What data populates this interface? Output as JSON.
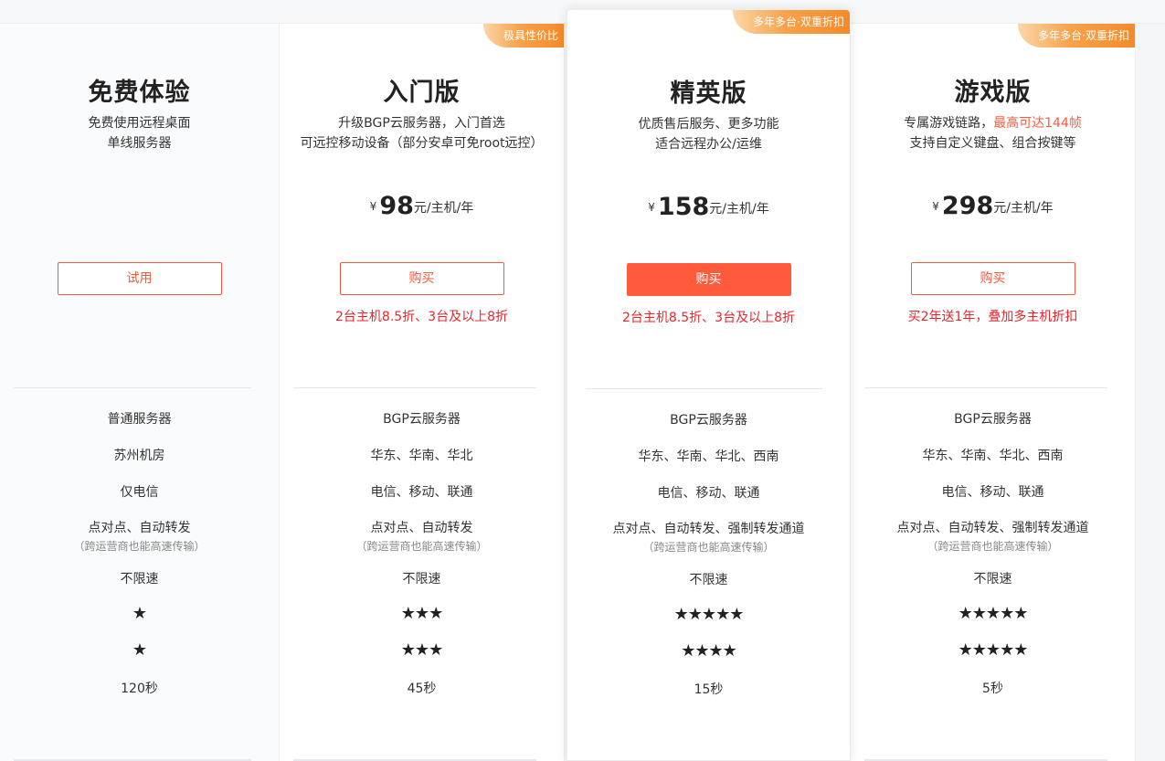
{
  "plans": [
    {
      "ribbon": "",
      "title": "免费体验",
      "desc_line1": "免费使用远程桌面",
      "desc_line2": "单线服务器",
      "desc_line2_highlight": "",
      "desc_line3": "",
      "price_symbol": "",
      "price_value": "",
      "price_unit": "",
      "button_label": "试用",
      "promo": "",
      "features": {
        "server": "普通服务器",
        "region": "苏州机房",
        "carrier": "仅电信",
        "transfer": "点对点、自动转发",
        "transfer_note": "（跨运营商也能高速传输）",
        "speed": "不限速",
        "rating_a": 1,
        "rating_b": 1,
        "time": "120秒"
      }
    },
    {
      "ribbon": "极具性价比",
      "title": "入门版",
      "desc_line1": "升级BGP云服务器，入门首选",
      "desc_line2": "可远控移动设备（部分安卓可免root远控）",
      "desc_line2_highlight": "",
      "desc_line3": "",
      "price_symbol": "¥",
      "price_value": "98",
      "price_unit": "元/主机/年",
      "button_label": "购买",
      "promo": "2台主机8.5折、3台及以上8折",
      "features": {
        "server": "BGP云服务器",
        "region": "华东、华南、华北",
        "carrier": "电信、移动、联通",
        "transfer": "点对点、自动转发",
        "transfer_note": "（跨运营商也能高速传输）",
        "speed": "不限速",
        "rating_a": 3,
        "rating_b": 3,
        "time": "45秒"
      }
    },
    {
      "ribbon": "多年多台·双重折扣",
      "title": "精英版",
      "desc_line1": "优质售后服务、更多功能",
      "desc_line2": "适合远程办公/运维",
      "desc_line2_highlight": "",
      "desc_line3": "",
      "price_symbol": "¥",
      "price_value": "158",
      "price_unit": "元/主机/年",
      "button_label": "购买",
      "promo": "2台主机8.5折、3台及以上8折",
      "features": {
        "server": "BGP云服务器",
        "region": "华东、华南、华北、西南",
        "carrier": "电信、移动、联通",
        "transfer": "点对点、自动转发、强制转发通道",
        "transfer_note": "（跨运营商也能高速传输）",
        "speed": "不限速",
        "rating_a": 5,
        "rating_b": 4,
        "time": "15秒"
      }
    },
    {
      "ribbon": "多年多台·双重折扣",
      "title": "游戏版",
      "desc_line1": "专属游戏链路，",
      "desc_line1_highlight": "最高可达144帧",
      "desc_line2": "支持自定义键盘、组合按键等",
      "desc_line3": "",
      "price_symbol": "¥",
      "price_value": "298",
      "price_unit": "元/主机/年",
      "button_label": "购买",
      "promo": "买2年送1年，叠加多主机折扣",
      "features": {
        "server": "BGP云服务器",
        "region": "华东、华南、华北、西南",
        "carrier": "电信、移动、联通",
        "transfer": "点对点、自动转发、强制转发通道",
        "transfer_note": "（跨运营商也能高速传输）",
        "speed": "不限速",
        "rating_a": 5,
        "rating_b": 5,
        "time": "5秒"
      }
    }
  ],
  "colors": {
    "accent": "#ff5a3c",
    "promo": "#e8252b",
    "ribbon_start": "#fcd6a8",
    "ribbon_end": "#f58a27"
  },
  "icons": {
    "star": "star-icon"
  }
}
